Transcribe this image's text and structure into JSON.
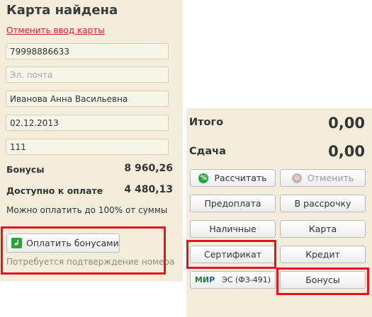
{
  "left": {
    "title": "Карта найдена",
    "cancel_link": "Отменить ввод карты",
    "fields": {
      "phone": "79998886633",
      "email_placeholder": "Эл. почта",
      "name": "Иванова Анна Васильевна",
      "birthdate": "02.12.2013",
      "code": "111"
    },
    "bonuses_label": "Бонусы",
    "bonuses_value": "8 960,26",
    "available_label": "Доступно к оплате",
    "available_value": "4 480,13",
    "note": "Можно оплатить до 100% от суммы",
    "pay_bonus_button": "Оплатить бонусами",
    "confirm_note": "Потребуется подтверждение номера"
  },
  "right": {
    "total_label": "Итого",
    "total_value": "0,00",
    "change_label": "Сдача",
    "change_value": "0,00",
    "buttons": {
      "calculate": "Рассчитать",
      "cancel": "Отменить",
      "prepayment": "Предоплата",
      "installment": "В рассрочку",
      "cash": "Наличные",
      "card": "Карта",
      "certificate": "Сертификат",
      "credit": "Кредит",
      "mir_es": "ЭС (ФЗ-491)",
      "bonuses": "Бонусы"
    },
    "mir_logo": {
      "m": "МИ",
      "r": "Р"
    }
  },
  "colors": {
    "highlight": "#e8121c",
    "panel": "#f3eedc",
    "link": "#e0132a",
    "green": "#29a33b"
  },
  "icons": {
    "enter": "enter-arrow-icon",
    "calculate": "percent-icon",
    "cancel": "cancel-icon"
  }
}
